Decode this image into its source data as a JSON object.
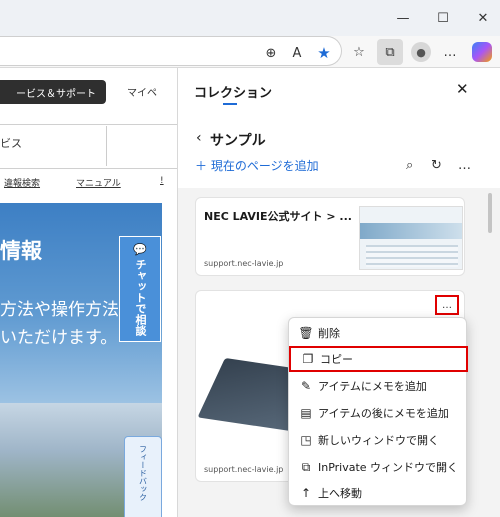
{
  "window": {
    "minimize_icon": "minimize-icon",
    "maximize_icon": "maximize-icon",
    "close_icon": "close-icon"
  },
  "toolbar": {
    "icons": [
      "zoom-icon",
      "read-aloud-icon",
      "favorite-star-icon",
      "favorites-icon",
      "collections-icon",
      "profile-icon",
      "more-icon",
      "copilot-icon"
    ],
    "accent_color": "#1e6bd6"
  },
  "webpage": {
    "service_button": "ービス＆サポート",
    "mypage": "マイペ",
    "service_text": "ビス",
    "links": [
      "違報検索",
      "マニュアル",
      "!"
    ],
    "hero_title": "情報",
    "hero_line1": "方法や操作方法",
    "hero_line2": "いただけます。",
    "chat_label": "チャットで相談",
    "feedback_label": "フィードバック"
  },
  "collections": {
    "title": "コレクション",
    "collection_name": "サンプル",
    "add_page": "現在のページを追加",
    "card1": {
      "title": "NEC LAVIE公式サイト > ...",
      "url": "support.nec-lavie.jp"
    },
    "card2": {
      "url": "support.nec-lavie.jp"
    },
    "more_label": "…"
  },
  "context_menu": {
    "items": [
      {
        "label": "削除",
        "icon": "trash-icon"
      },
      {
        "label": "コピー",
        "icon": "copy-icon",
        "highlighted": true
      },
      {
        "label": "アイテムにメモを追加",
        "icon": "note-icon"
      },
      {
        "label": "アイテムの後にメモを追加",
        "icon": "note-below-icon"
      },
      {
        "label": "新しいウィンドウで開く",
        "icon": "new-window-icon"
      },
      {
        "label": "InPrivate ウィンドウで開く",
        "icon": "inprivate-icon"
      },
      {
        "label": "上へ移動",
        "icon": "arrow-up-icon"
      }
    ],
    "highlight_color": "#e00000"
  }
}
